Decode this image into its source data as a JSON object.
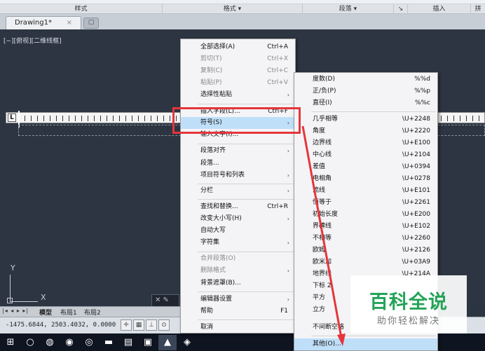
{
  "ribbon": {
    "groups": [
      "样式",
      "格式 ▾",
      "段落 ▾",
      "↘",
      "插入",
      "拼"
    ]
  },
  "tabs": {
    "doc_title": "Drawing1*",
    "close": "×",
    "new_tab": "▢"
  },
  "viewport": {
    "view_label": "[−][俯视][二维线框]",
    "ucs_y": "Y",
    "ucs_x": "X",
    "cmd_icons": "✕ ✎"
  },
  "layout_tabs": {
    "nav": "|◂ ◂ ▸ ▸|",
    "model": "模型",
    "layout1": "布局1",
    "layout2": "布局2"
  },
  "status": {
    "coords": "-1475.6844, 2503.4032, 0.0000"
  },
  "menu": [
    {
      "label": "全部选择(A)",
      "shortcut": "Ctrl+A"
    },
    {
      "label": "剪切(T)",
      "shortcut": "Ctrl+X",
      "disabled": true
    },
    {
      "label": "复制(C)",
      "shortcut": "Ctrl+C",
      "disabled": true
    },
    {
      "label": "粘贴(P)",
      "shortcut": "Ctrl+V",
      "disabled": true
    },
    {
      "label": "选择性粘贴",
      "submenu": true
    },
    {
      "label": "插入字段(L)...",
      "shortcut": "Ctrl+F"
    },
    {
      "label": "符号(S)",
      "submenu": true,
      "highlight": true
    },
    {
      "label": "输入文字(I)..."
    },
    {
      "label": "段落对齐",
      "submenu": true
    },
    {
      "label": "段落..."
    },
    {
      "label": "项目符号和列表",
      "submenu": true
    },
    {
      "label": "分栏",
      "submenu": true
    },
    {
      "label": "查找和替换...",
      "shortcut": "Ctrl+R"
    },
    {
      "label": "改变大小写(H)",
      "submenu": true
    },
    {
      "label": "自动大写"
    },
    {
      "label": "字符集",
      "submenu": true
    },
    {
      "label": "合并段落(O)",
      "disabled": true
    },
    {
      "label": "删除格式",
      "submenu": true,
      "disabled": true
    },
    {
      "label": "背景遮罩(B)..."
    },
    {
      "label": "编辑器设置",
      "submenu": true
    },
    {
      "label": "帮助",
      "shortcut": "F1"
    },
    {
      "label": "取消"
    }
  ],
  "symbols": [
    {
      "label": "度数(D)",
      "code": "%%d"
    },
    {
      "label": "正/负(P)",
      "code": "%%p"
    },
    {
      "label": "直径(I)",
      "code": "%%c"
    },
    {
      "label": "几乎相等",
      "code": "\\U+2248"
    },
    {
      "label": "角度",
      "code": "\\U+2220"
    },
    {
      "label": "边界线",
      "code": "\\U+E100"
    },
    {
      "label": "中心线",
      "code": "\\U+2104"
    },
    {
      "label": "差值",
      "code": "\\U+0394"
    },
    {
      "label": "电相角",
      "code": "\\U+0278"
    },
    {
      "label": "流线",
      "code": "\\U+E101"
    },
    {
      "label": "恒等于",
      "code": "\\U+2261"
    },
    {
      "label": "初始长度",
      "code": "\\U+E200"
    },
    {
      "label": "界碑线",
      "code": "\\U+E102"
    },
    {
      "label": "不相等",
      "code": "\\U+2260"
    },
    {
      "label": "欧姆",
      "code": "\\U+2126"
    },
    {
      "label": "欧米加",
      "code": "\\U+03A9"
    },
    {
      "label": "地界线",
      "code": "\\U+214A"
    },
    {
      "label": "下标 2",
      "code": ""
    },
    {
      "label": "平方",
      "code": ""
    },
    {
      "label": "立方",
      "code": ""
    },
    {
      "label": "不间断空格",
      "code": ""
    },
    {
      "label": "其他(O)..."
    }
  ],
  "watermark": {
    "title": "百科全说",
    "subtitle": "助你轻松解决"
  },
  "colors": {
    "highlight": "#bfdff9",
    "annotation_red": "#e4363a",
    "watermark_green": "#23a357"
  }
}
